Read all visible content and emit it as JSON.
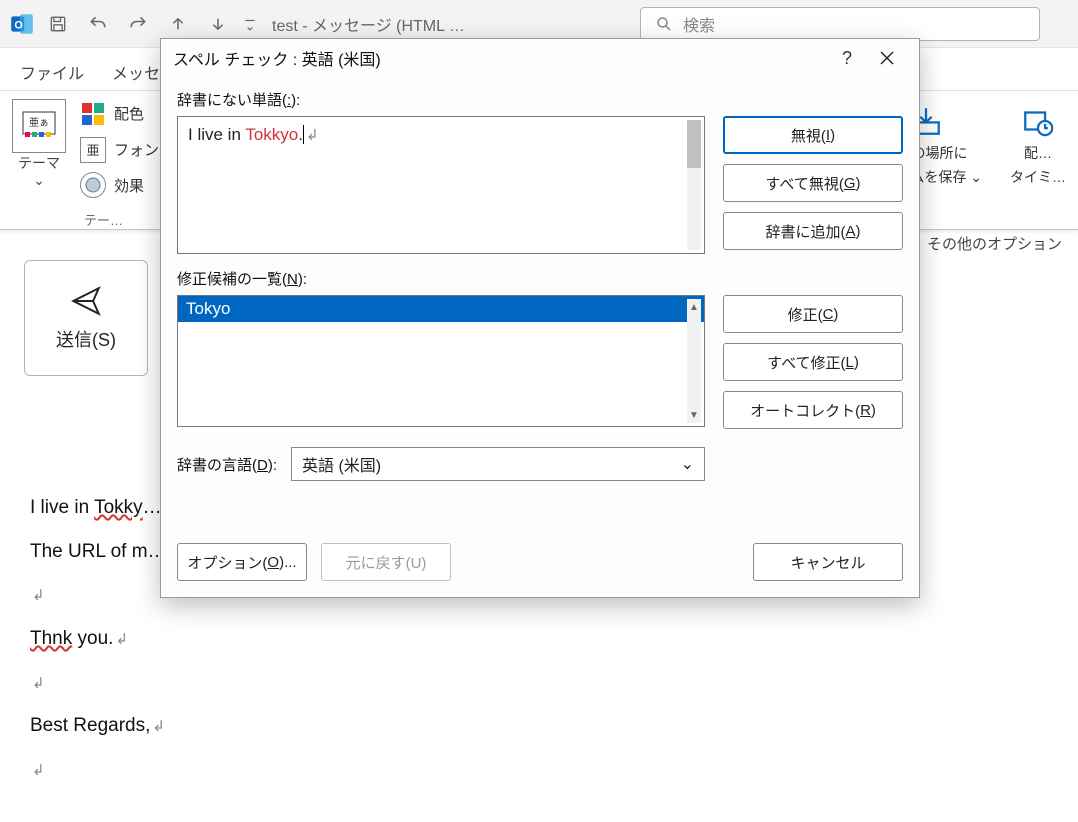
{
  "titlebar": {
    "window_title": "test - メッセージ (HTML …",
    "search_placeholder": "検索"
  },
  "tabs": {
    "file": "ファイル",
    "message": "メッセー…"
  },
  "ribbon": {
    "theme_label": "テーマ",
    "theme_chevron": "⌄",
    "colors": "配色",
    "fonts": "フォン…",
    "effects": "効果",
    "group_caption": "テー…",
    "save_loc_line1": "…定の場所に",
    "save_loc_line2": "…イテムを保存",
    "timing_line1": "配…",
    "timing_line2": "タイミ…",
    "more_options": "その他のオプション"
  },
  "compose": {
    "send_label": "送信(S)"
  },
  "body": {
    "line1_pre": "I live in ",
    "line1_err": "Tokky",
    "line1_cut": "…",
    "line2": "The URL of m…",
    "line3_err": "Thnk",
    "line3_post": " you.",
    "line4": "Best Regards,"
  },
  "dialog": {
    "title": "スペル チェック : 英語 (米国)",
    "help": "?",
    "not_in_dict_label_pre": "辞書にない単語(",
    "not_in_dict_key": ":",
    "not_in_dict_label_post": "):",
    "sentence_pre": "I live in ",
    "sentence_err": "Tokkyo",
    "sentence_post": ".",
    "ignore": "無視(",
    "ignore_key": "I",
    "ignore_all": "すべて無視(",
    "ignore_all_key": "G",
    "add_dict": "辞書に追加(",
    "add_dict_key": "A",
    "suggestions_label_pre": "修正候補の一覧(",
    "suggestions_key": "N",
    "suggestions_label_post": "):",
    "suggestion1": "Tokyo",
    "change": "修正(",
    "change_key": "C",
    "change_all": "すべて修正(",
    "change_all_key": "L",
    "autocorrect": "オートコレクト(",
    "autocorrect_key": "R",
    "lang_label_pre": "辞書の言語(",
    "lang_key": "D",
    "lang_label_post": "):",
    "lang_value": "英語 (米国)",
    "options": "オプション(",
    "options_key": "O",
    "options_post": ")...",
    "undo": "元に戻す(U)",
    "cancel": "キャンセル",
    "close_paren": ")"
  }
}
